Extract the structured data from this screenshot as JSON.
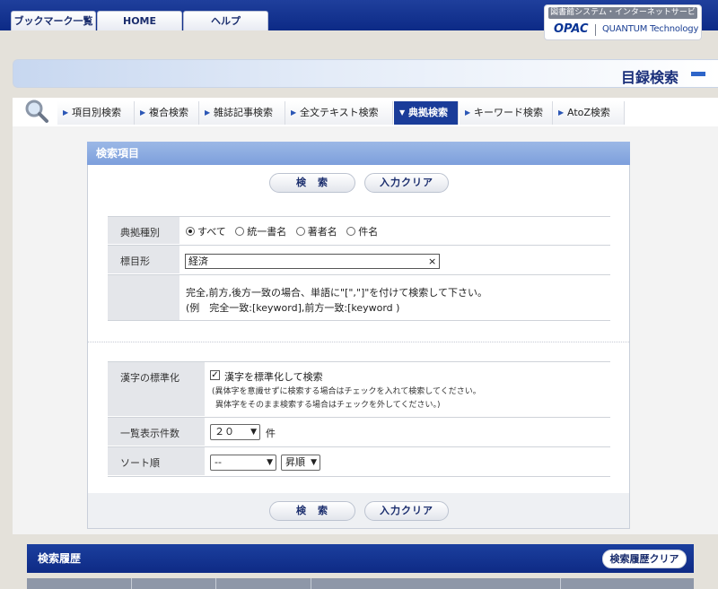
{
  "top_nav": {
    "tabs": [
      {
        "label": "ブックマーク一覧"
      },
      {
        "label": "HOME"
      },
      {
        "label": "ヘルプ"
      }
    ],
    "brand": {
      "service": "図書館システム・インターネットサービス",
      "opac": "OPAC",
      "vendor": "QUANTUM Technology"
    }
  },
  "page_title": "目録検索",
  "search_tabs": [
    {
      "label": "項目別検索",
      "active": false
    },
    {
      "label": "複合検索",
      "active": false
    },
    {
      "label": "雑誌記事検索",
      "active": false
    },
    {
      "label": "全文テキスト検索",
      "active": false
    },
    {
      "label": "典拠検索",
      "active": true
    },
    {
      "label": "キーワード検索",
      "active": false
    },
    {
      "label": "AtoZ検索",
      "active": false
    }
  ],
  "search_box": {
    "title": "検索項目",
    "search_button": "検　索",
    "clear_button": "入力クリア",
    "authority_type": {
      "label": "典拠種別",
      "options": [
        "すべて",
        "統一書名",
        "著者名",
        "件名"
      ],
      "selected": "すべて"
    },
    "heading": {
      "label": "標目形",
      "value": "経済",
      "clear_icon": "×"
    },
    "help": {
      "line1": "完全,前方,後方一致の場合、単語に\"[\",\"]\"を付けて検索して下さい。",
      "line2": "(例　完全一致:[keyword],前方一致:[keyword )"
    },
    "kanji": {
      "label": "漢字の標準化",
      "checkbox_label": "漢字を標準化して検索",
      "checked": true,
      "note1": "(異体字を意識せずに検索する場合はチェックを入れて検索してください。",
      "note2": "異体字をそのまま検索する場合はチェックを外してください。)"
    },
    "count": {
      "label": "一覧表示件数",
      "value": "２０",
      "unit": "件"
    },
    "sort": {
      "label": "ソート順",
      "value": "--",
      "order": "昇順"
    }
  },
  "history": {
    "title": "検索履歴",
    "clear_button": "検索履歴クリア"
  },
  "colors": {
    "nav_blue": "#0c2a86",
    "active_tab": "#1a3c99",
    "box_header": "#7d9fdc"
  }
}
